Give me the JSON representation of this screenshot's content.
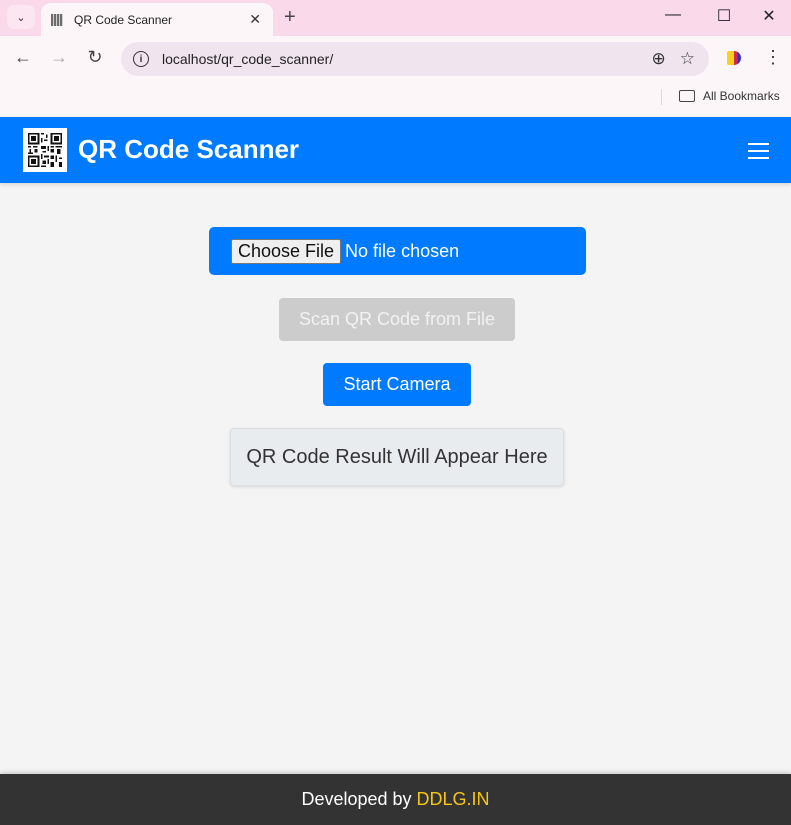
{
  "browser": {
    "tab_title": "QR Code Scanner",
    "tab_favicon": "qr-code-icon",
    "url": "localhost/qr_code_scanner/",
    "bookmarks_label": "All Bookmarks",
    "icons": {
      "tab_search": "chevron-down-icon",
      "close_tab": "close-icon",
      "new_tab": "plus-icon",
      "back": "arrow-left-icon",
      "forward": "arrow-right-icon",
      "reload": "reload-icon",
      "site_info": "info-icon",
      "zoom": "zoom-in-icon",
      "bookmark": "star-icon",
      "extension": "extension-icon",
      "menu": "more-vert-icon",
      "folder": "folder-icon"
    },
    "glyphs": {
      "tab_search": "⌄",
      "close_tab": "✕",
      "new_tab": "+",
      "minimize": "—",
      "maximize": "☐",
      "close_window": "✕",
      "back": "←",
      "forward": "→",
      "reload": "↻",
      "info": "i",
      "zoom": "⊕",
      "star": "☆",
      "menu": "⋮"
    }
  },
  "header": {
    "title": "QR Code Scanner",
    "logo": "qr-code-icon",
    "menu_icon": "hamburger-menu-icon",
    "background": "#007bff"
  },
  "main": {
    "file_input": {
      "button_label": "Choose File",
      "status": "No file chosen"
    },
    "scan_button": {
      "label": "Scan QR Code from File",
      "disabled": true
    },
    "camera_button": {
      "label": "Start Camera"
    },
    "result": {
      "text": "QR Code Result Will Appear Here"
    }
  },
  "footer": {
    "prefix": "Developed by",
    "link_text": "DDLG.IN",
    "link_color": "#f5c518",
    "background": "#333333"
  }
}
